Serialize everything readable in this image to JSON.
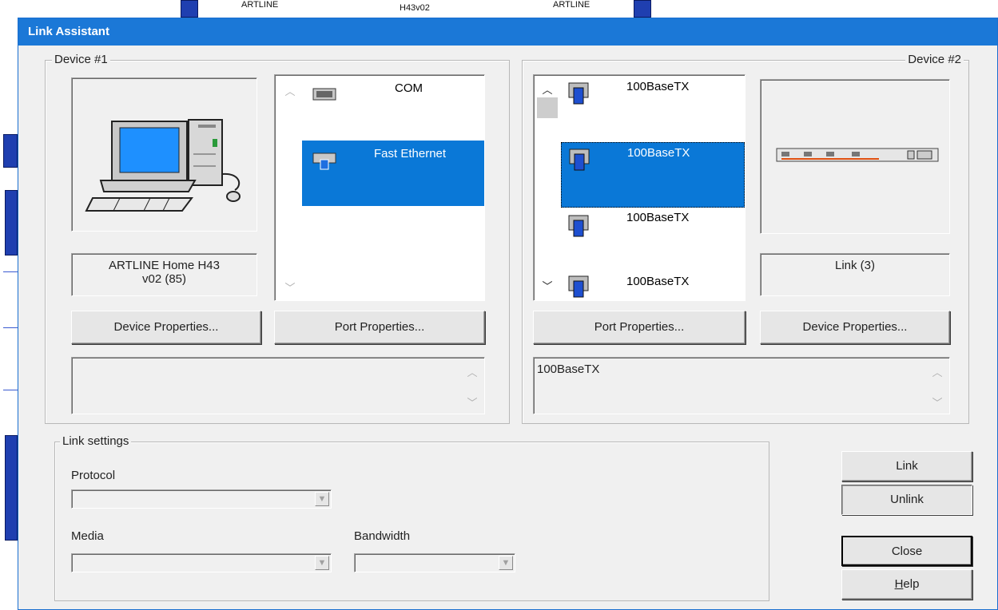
{
  "background": {
    "labels": [
      "ARTLINE",
      "H43v02",
      "ARTLINE"
    ]
  },
  "dialog": {
    "title": "Link Assistant",
    "device1": {
      "legend": "Device #1",
      "name": "ARTLINE Home H43",
      "name_line2": "v02 (85)",
      "ports": [
        {
          "label": "COM",
          "selected": false,
          "icon": "serial-port-icon"
        },
        {
          "label": "Fast Ethernet",
          "selected": true,
          "icon": "ethernet-port-icon"
        }
      ],
      "device_properties_label": "Device Properties...",
      "port_properties_label": "Port Properties...",
      "description": ""
    },
    "device2": {
      "legend": "Device #2",
      "name": "Link (3)",
      "ports": [
        {
          "label": "100BaseTX",
          "selected": false
        },
        {
          "label": "100BaseTX",
          "selected": true
        },
        {
          "label": "100BaseTX",
          "selected": false
        },
        {
          "label": "100BaseTX",
          "selected": false
        }
      ],
      "device_properties_label": "Device Properties...",
      "port_properties_label": "Port Properties...",
      "description": "100BaseTX"
    },
    "link_settings": {
      "legend": "Link settings",
      "protocol_label": "Protocol",
      "protocol_value": "",
      "media_label": "Media",
      "media_value": "",
      "bandwidth_label": "Bandwidth",
      "bandwidth_value": ""
    },
    "buttons": {
      "link": "Link",
      "unlink": "Unlink",
      "close": "Close",
      "help_prefix": "H",
      "help_rest": "elp"
    }
  }
}
